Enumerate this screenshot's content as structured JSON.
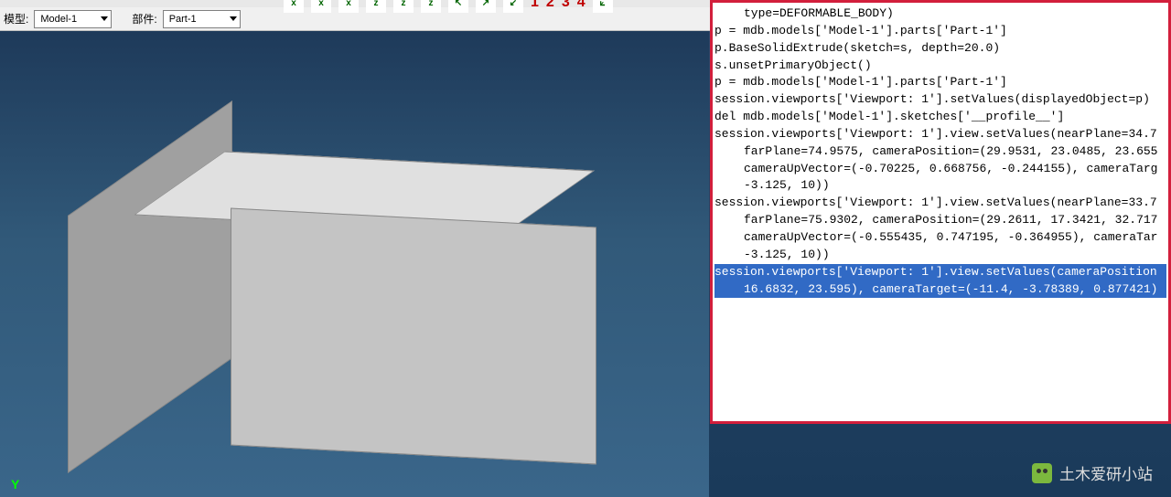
{
  "selectors": {
    "model_label": "模型:",
    "model_value": "Model-1",
    "part_label": "部件:",
    "part_value": "Part-1"
  },
  "icon_row": {
    "axes": [
      "x",
      "x",
      "x",
      "z",
      "z",
      "z"
    ],
    "triads": [
      "1",
      "2",
      "3"
    ],
    "nums": [
      "1",
      "2",
      "3",
      "4"
    ]
  },
  "viewport": {
    "y_label": "Y"
  },
  "code": {
    "lines": [
      {
        "cls": "indent1",
        "text": "type=DEFORMABLE_BODY)"
      },
      {
        "cls": "",
        "text": "p = mdb.models['Model-1'].parts['Part-1']"
      },
      {
        "cls": "",
        "text": "p.BaseSolidExtrude(sketch=s, depth=20.0)"
      },
      {
        "cls": "",
        "text": "s.unsetPrimaryObject()"
      },
      {
        "cls": "",
        "text": "p = mdb.models['Model-1'].parts['Part-1']"
      },
      {
        "cls": "",
        "text": "session.viewports['Viewport: 1'].setValues(displayedObject=p)"
      },
      {
        "cls": "",
        "text": "del mdb.models['Model-1'].sketches['__profile__']"
      },
      {
        "cls": "",
        "text": "session.viewports['Viewport: 1'].view.setValues(nearPlane=34.7"
      },
      {
        "cls": "indent1",
        "text": "farPlane=74.9575, cameraPosition=(29.9531, 23.0485, 23.655"
      },
      {
        "cls": "indent1",
        "text": "cameraUpVector=(-0.70225, 0.668756, -0.244155), cameraTarg"
      },
      {
        "cls": "indent1",
        "text": "-3.125, 10))"
      },
      {
        "cls": "",
        "text": "session.viewports['Viewport: 1'].view.setValues(nearPlane=33.7"
      },
      {
        "cls": "indent1",
        "text": "farPlane=75.9302, cameraPosition=(29.2611, 17.3421, 32.717"
      },
      {
        "cls": "indent1",
        "text": "cameraUpVector=(-0.555435, 0.747195, -0.364955), cameraTar"
      },
      {
        "cls": "indent1",
        "text": "-3.125, 10))"
      }
    ],
    "highlighted": [
      {
        "cls": "code-hl",
        "text": "session.viewports['Viewport: 1'].view.setValues(cameraPosition"
      },
      {
        "cls": "code-hl indent1",
        "text": "16.6832, 23.595), cameraTarget=(-11.4, -3.78389, 0.877421)"
      }
    ]
  },
  "watermark": {
    "text": "土木爱研小站"
  }
}
